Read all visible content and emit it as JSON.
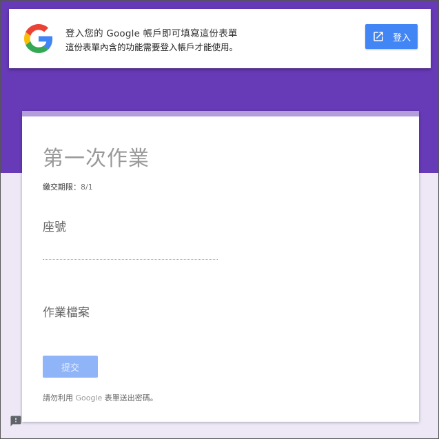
{
  "signin_banner": {
    "line1": "登入您的 Google 帳戶即可填寫這份表單",
    "line2": "這份表單內含的功能需要登入帳戶才能使用。",
    "button_label": "登入",
    "logo_icon": "google-g-icon",
    "button_icon": "open-in-new-icon"
  },
  "form": {
    "title": "第一次作業",
    "due_prefix": "繳交期限：",
    "due_value": "8/1",
    "questions": [
      {
        "label": "座號",
        "value": ""
      },
      {
        "label": "作業檔案"
      }
    ],
    "submit_label": "提交",
    "footer_prefix": "請勿利用 ",
    "footer_brand": "Google",
    "footer_suffix": " 表單送出密碼。"
  },
  "report_icon": "report-problem-icon",
  "colors": {
    "header_bg": "#673ab7",
    "page_bg": "#ede7f6",
    "card_accent": "#b39ddb",
    "primary_button": "#4285f4",
    "disabled_button": "#90b4f8"
  }
}
